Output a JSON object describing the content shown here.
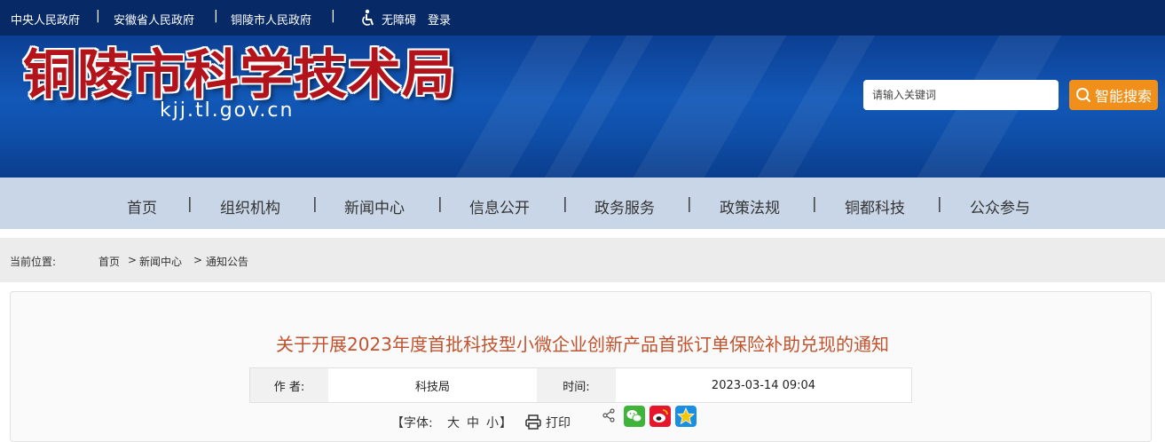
{
  "topbar": {
    "links": [
      "中央人民政府",
      "安徽省人民政府",
      "铜陵市人民政府"
    ],
    "separator": "|",
    "accessibility": "无障碍",
    "login": "登录"
  },
  "header": {
    "site_title": "铜陵市科学技术局",
    "domain": "kjj.tl.gov.cn",
    "search_placeholder": "请输入关键词",
    "search_button": "智能搜索"
  },
  "nav": {
    "items": [
      "首页",
      "组织机构",
      "新闻中心",
      "信息公开",
      "政务服务",
      "政策法规",
      "铜都科技",
      "公众参与"
    ],
    "separator": "|"
  },
  "breadcrumb": {
    "label": "当前位置:",
    "path": [
      "首页",
      "新闻中心",
      "通知公告"
    ],
    "arrow": ">"
  },
  "article": {
    "title": "关于开展2023年度首批科技型小微企业创新产品首张订单保险补助兑现的通知",
    "author_label": "作  者:",
    "author_value": "科技局",
    "time_label": "时间:",
    "time_value": "2023-03-14 09:04"
  },
  "tools": {
    "font_label": "【字体:",
    "font_large": "大",
    "font_medium": "中",
    "font_small": "小",
    "font_close": "】",
    "print": "打印"
  },
  "colors": {
    "topbar": "#072a66",
    "banner": "#1258b7",
    "nav": "#c9d6e7",
    "accent": "#f08f1a",
    "title": "#c0532e"
  }
}
